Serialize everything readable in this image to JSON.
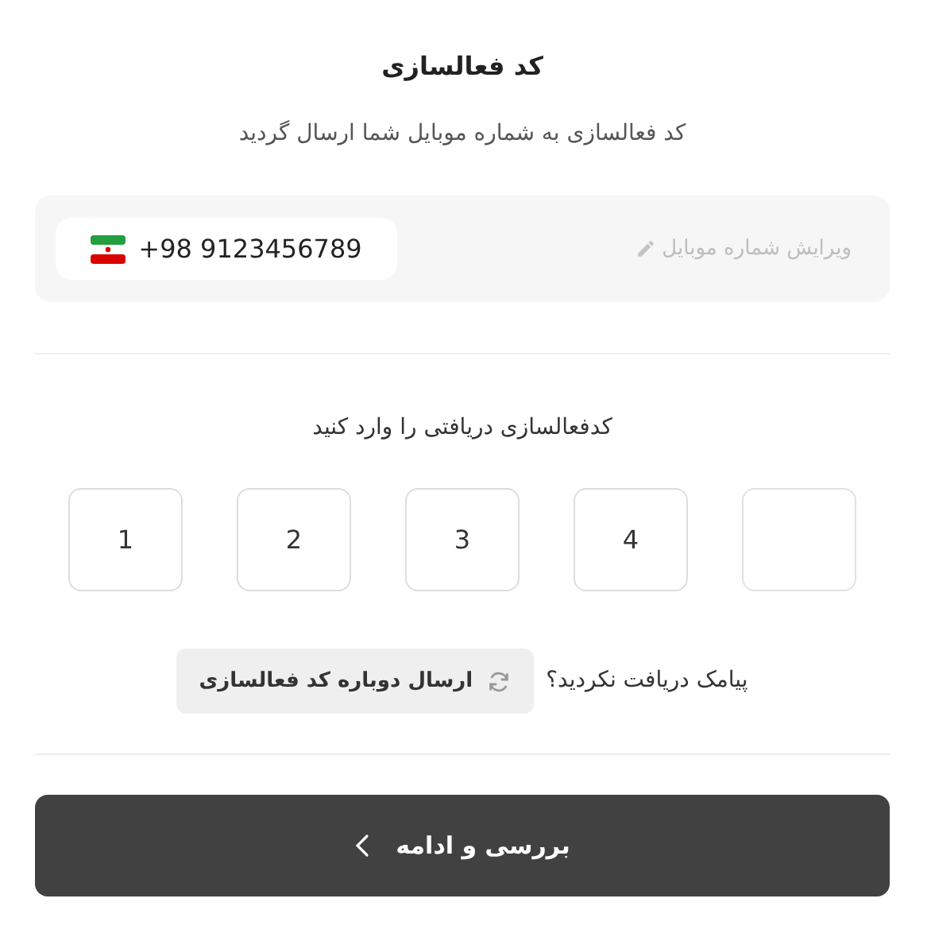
{
  "title": "کد فعالسازی",
  "subtitle": "کد فعالسازی به شماره موبایل شما ارسال گردید",
  "phone": {
    "edit_label": "ویرایش شماره موبایل",
    "number": "+98 9123456789"
  },
  "prompt": "کدفعالسازی دریافتی را وارد کنید",
  "code_inputs": [
    {
      "kind": "empty"
    },
    {
      "kind": "filled",
      "value": "4"
    },
    {
      "kind": "filled",
      "value": "3"
    },
    {
      "kind": "filled",
      "value": "2"
    },
    {
      "kind": "filled",
      "value": "1"
    }
  ],
  "resend": {
    "question": "پیامک دریافت نکردید؟",
    "button": "ارسال دوباره کد فعالسازی"
  },
  "submit": {
    "label": "بررسی و ادامه"
  }
}
